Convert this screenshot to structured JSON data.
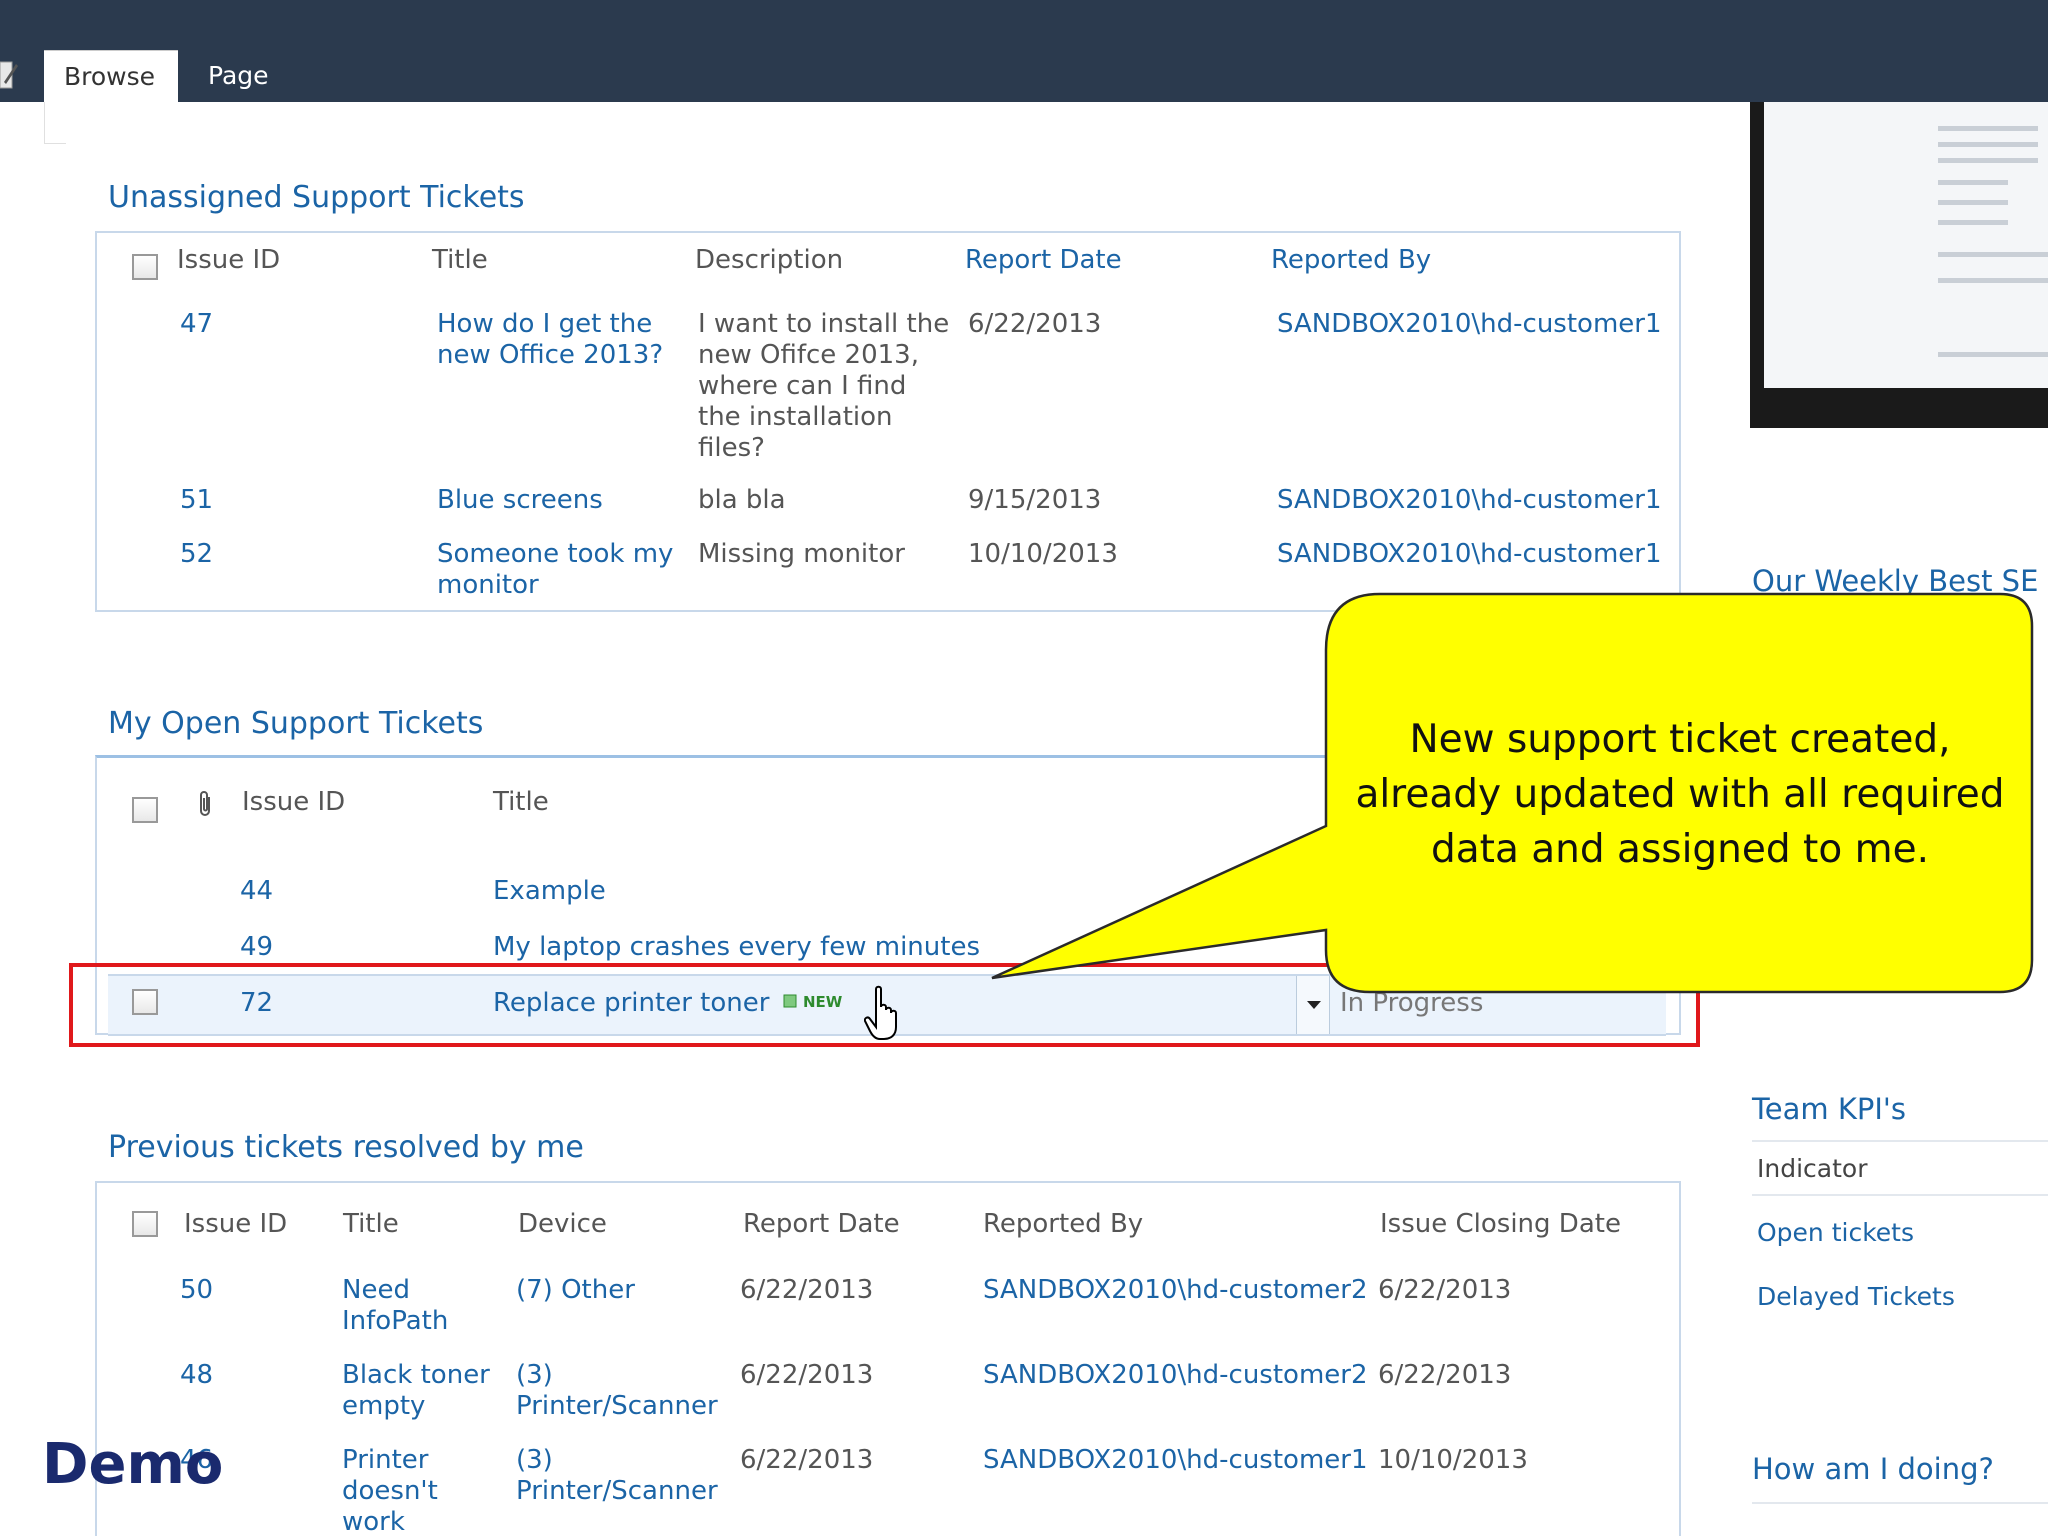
{
  "ribbon": {
    "tabs": [
      {
        "label": "Browse"
      },
      {
        "label": "Page"
      }
    ]
  },
  "unassigned": {
    "title": "Unassigned Support Tickets",
    "columns": [
      "Issue ID",
      "Title",
      "Description",
      "Report Date",
      "Reported By"
    ],
    "rows": [
      {
        "id": "47",
        "title": "How do I get the\nnew Office 2013?",
        "description": "I want to install the\nnew Ofifce 2013,\nwhere can I find\nthe installation\nfiles?",
        "date": "6/22/2013",
        "by": "SANDBOX2010\\hd-customer1"
      },
      {
        "id": "51",
        "title": "Blue screens",
        "description": "bla bla",
        "date": "9/15/2013",
        "by": "SANDBOX2010\\hd-customer1"
      },
      {
        "id": "52",
        "title": "Someone took my\nmonitor",
        "description": "Missing monitor",
        "date": "10/10/2013",
        "by": "SANDBOX2010\\hd-customer1"
      }
    ]
  },
  "open": {
    "title": "My Open Support Tickets",
    "columns": [
      "Issue ID",
      "Title"
    ],
    "rows": [
      {
        "id": "44",
        "title": "Example"
      },
      {
        "id": "49",
        "title": "My laptop crashes every few minutes"
      },
      {
        "id": "72",
        "title": "Replace printer toner",
        "badge": "NEW",
        "status": "In Progress"
      }
    ]
  },
  "resolved": {
    "title": "Previous tickets resolved by me",
    "columns": [
      "Issue ID",
      "Title",
      "Device",
      "Report Date",
      "Reported By",
      "Issue Closing Date"
    ],
    "rows": [
      {
        "id": "50",
        "title": "Need\nInfoPath",
        "device": "(7) Other",
        "date": "6/22/2013",
        "by": "SANDBOX2010\\hd-customer2",
        "closed": "6/22/2013"
      },
      {
        "id": "48",
        "title": "Black toner\nempty",
        "device": "(3)\nPrinter/Scanner",
        "date": "6/22/2013",
        "by": "SANDBOX2010\\hd-customer2",
        "closed": "6/22/2013"
      },
      {
        "id": "46",
        "title": "Printer\ndoesn't\nwork",
        "device": "(3)\nPrinter/Scanner",
        "date": "6/22/2013",
        "by": "SANDBOX2010\\hd-customer1",
        "closed": "10/10/2013"
      }
    ]
  },
  "sidebar": {
    "weekly_title": "Our Weekly Best SE",
    "kpi_title": "Team KPI's",
    "kpi_header": "Indicator",
    "kpi_items": [
      "Open tickets",
      "Delayed Tickets"
    ],
    "doing_title": "How am I doing?"
  },
  "callout": {
    "lines": [
      "New support ticket created,",
      "already updated with all required",
      "data and assigned to me."
    ]
  },
  "overlay": {
    "demo_label": "Demo"
  },
  "colors": {
    "ribbon": "#2b3a4e",
    "link": "#1b64a6",
    "callout": "#ffff00",
    "highlight": "#e0181b"
  }
}
